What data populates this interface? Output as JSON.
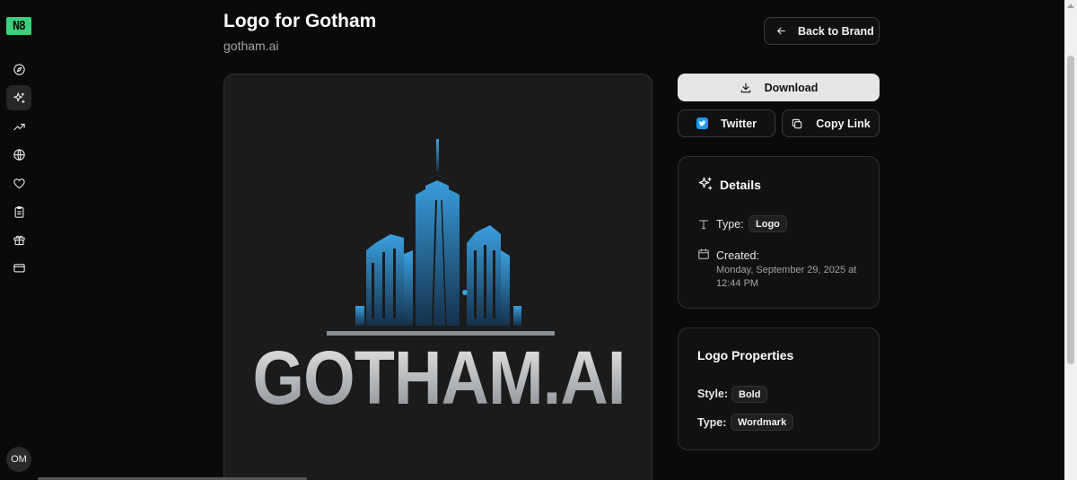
{
  "rail": {
    "logo_text": "N8",
    "items": [
      {
        "icon": "compass-icon"
      },
      {
        "icon": "sparkles-icon",
        "active": true
      },
      {
        "icon": "trending-up-icon"
      },
      {
        "icon": "globe-icon"
      },
      {
        "icon": "heart-icon"
      },
      {
        "icon": "clipboard-icon"
      },
      {
        "icon": "gift-icon"
      },
      {
        "icon": "credit-card-icon"
      }
    ],
    "avatar_initials": "OM"
  },
  "header": {
    "title": "Logo for Gotham",
    "subtitle": "gotham.ai",
    "back_label": "Back to Brand"
  },
  "preview": {
    "wordmark": "GOTHAM.AI",
    "colors": {
      "building_top": "#3aa0e0",
      "building_bottom": "#14314c",
      "wordmark": "#c8cbce"
    }
  },
  "actions": {
    "download_label": "Download",
    "twitter_label": "Twitter",
    "copy_label": "Copy Link"
  },
  "details": {
    "title": "Details",
    "type_label": "Type:",
    "type_value": "Logo",
    "created_label": "Created:",
    "created_value": "Monday, September 29, 2025 at 12:44 PM"
  },
  "properties": {
    "title": "Logo Properties",
    "style_label": "Style:",
    "style_value": "Bold",
    "type_label": "Type:",
    "type_value": "Wordmark"
  },
  "colors": {
    "accent_green": "#3ad17a",
    "twitter_blue": "#1d9bf0"
  }
}
